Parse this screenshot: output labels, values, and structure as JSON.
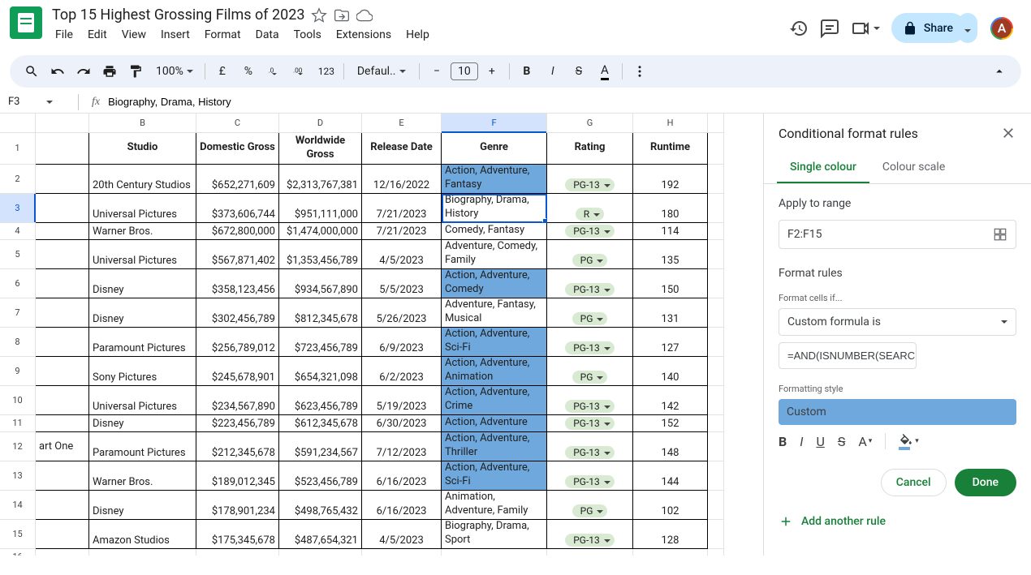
{
  "doc": {
    "title": "Top 15 Highest Grossing Films of 2023"
  },
  "menubar": [
    "File",
    "Edit",
    "View",
    "Insert",
    "Format",
    "Data",
    "Tools",
    "Extensions",
    "Help"
  ],
  "toolbar": {
    "zoom": "100%",
    "currency": "£",
    "percent": "%",
    "num_fmt": "123",
    "font": "Defaul...",
    "size": "10"
  },
  "share": {
    "label": "Share"
  },
  "avatar": {
    "initial": "A"
  },
  "namebox": {
    "ref": "F3",
    "formula": "Biography, Drama, History"
  },
  "columns": [
    "B",
    "C",
    "D",
    "E",
    "F",
    "G",
    "H"
  ],
  "headers": [
    "Studio",
    "Domestic Gross",
    "Worldwide Gross",
    "Release Date",
    "Genre",
    "Rating",
    "Runtime"
  ],
  "rows": [
    {
      "n": 2,
      "a": "",
      "b": "20th Century Studios",
      "c": "$652,271,609",
      "d": "$2,313,767,381",
      "e": "12/16/2022",
      "f": "Action, Adventure, Fantasy",
      "g": "PG-13",
      "h": "192",
      "hl": true,
      "tall": true
    },
    {
      "n": 3,
      "a": "",
      "b": "Universal Pictures",
      "c": "$373,606,744",
      "d": "$951,111,000",
      "e": "7/21/2023",
      "f": "Biography, Drama, History",
      "g": "R",
      "h": "180",
      "hl": false,
      "tall": true,
      "active": true
    },
    {
      "n": 4,
      "a": "",
      "b": "Warner Bros.",
      "c": "$672,800,000",
      "d": "$1,474,000,000",
      "e": "7/21/2023",
      "f": "Comedy, Fantasy",
      "g": "PG-13",
      "h": "114",
      "hl": false,
      "tall": false
    },
    {
      "n": 5,
      "a": "",
      "b": "Universal Pictures",
      "c": "$567,871,402",
      "d": "$1,353,456,789",
      "e": "4/5/2023",
      "f": "Adventure, Comedy, Family",
      "g": "PG",
      "h": "135",
      "hl": false,
      "tall": true
    },
    {
      "n": 6,
      "a": "",
      "b": "Disney",
      "c": "$358,123,456",
      "d": "$934,567,890",
      "e": "5/5/2023",
      "f": "Action, Adventure, Comedy",
      "g": "PG-13",
      "h": "150",
      "hl": true,
      "tall": true
    },
    {
      "n": 7,
      "a": "",
      "b": "Disney",
      "c": "$302,456,789",
      "d": "$812,345,678",
      "e": "5/26/2023",
      "f": "Adventure, Fantasy, Musical",
      "g": "PG",
      "h": "131",
      "hl": false,
      "tall": true
    },
    {
      "n": 8,
      "a": "",
      "b": "Paramount Pictures",
      "c": "$256,789,012",
      "d": "$723,456,789",
      "e": "6/9/2023",
      "f": "Action, Adventure, Sci-Fi",
      "g": "PG-13",
      "h": "127",
      "hl": true,
      "tall": true
    },
    {
      "n": 9,
      "a": "",
      "b": "Sony Pictures",
      "c": "$245,678,901",
      "d": "$654,321,098",
      "e": "6/2/2023",
      "f": "Action, Adventure, Animation",
      "g": "PG",
      "h": "140",
      "hl": true,
      "tall": true
    },
    {
      "n": 10,
      "a": "",
      "b": "Universal Pictures",
      "c": "$234,567,890",
      "d": "$623,456,789",
      "e": "5/19/2023",
      "f": "Action, Adventure, Crime",
      "g": "PG-13",
      "h": "142",
      "hl": true,
      "tall": true
    },
    {
      "n": 11,
      "a": "",
      "b": "Disney",
      "c": "$223,456,789",
      "d": "$612,345,678",
      "e": "6/30/2023",
      "f": "Action, Adventure",
      "g": "PG-13",
      "h": "152",
      "hl": true,
      "tall": false
    },
    {
      "n": 12,
      "a": "art One",
      "b": "Paramount Pictures",
      "c": "$212,345,678",
      "d": "$591,234,567",
      "e": "7/12/2023",
      "f": "Action, Adventure, Thriller",
      "g": "PG-13",
      "h": "148",
      "hl": true,
      "tall": true
    },
    {
      "n": 13,
      "a": "",
      "b": "Warner Bros.",
      "c": "$189,012,345",
      "d": "$523,456,789",
      "e": "6/16/2023",
      "f": "Action, Adventure, Sci-Fi",
      "g": "PG-13",
      "h": "144",
      "hl": true,
      "tall": true
    },
    {
      "n": 14,
      "a": "",
      "b": "Disney",
      "c": "$178,901,234",
      "d": "$498,765,432",
      "e": "6/16/2023",
      "f": "Animation, Adventure, Family",
      "g": "PG",
      "h": "102",
      "hl": false,
      "tall": true
    },
    {
      "n": 15,
      "a": "",
      "b": "Amazon Studios",
      "c": "$175,345,678",
      "d": "$487,654,321",
      "e": "4/5/2023",
      "f": "Biography, Drama, Sport",
      "g": "PG-13",
      "h": "128",
      "hl": false,
      "tall": true
    }
  ],
  "sidebar": {
    "title": "Conditional format rules",
    "tabs": [
      "Single colour",
      "Colour scale"
    ],
    "apply_label": "Apply to range",
    "range": "F2:F15",
    "rules_label": "Format rules",
    "cells_if_label": "Format cells if...",
    "rule_type": "Custom formula is",
    "formula": "=AND(ISNUMBER(SEARCH",
    "style_label": "Formatting style",
    "style_name": "Custom",
    "cancel": "Cancel",
    "done": "Done",
    "add_rule": "Add another rule"
  }
}
